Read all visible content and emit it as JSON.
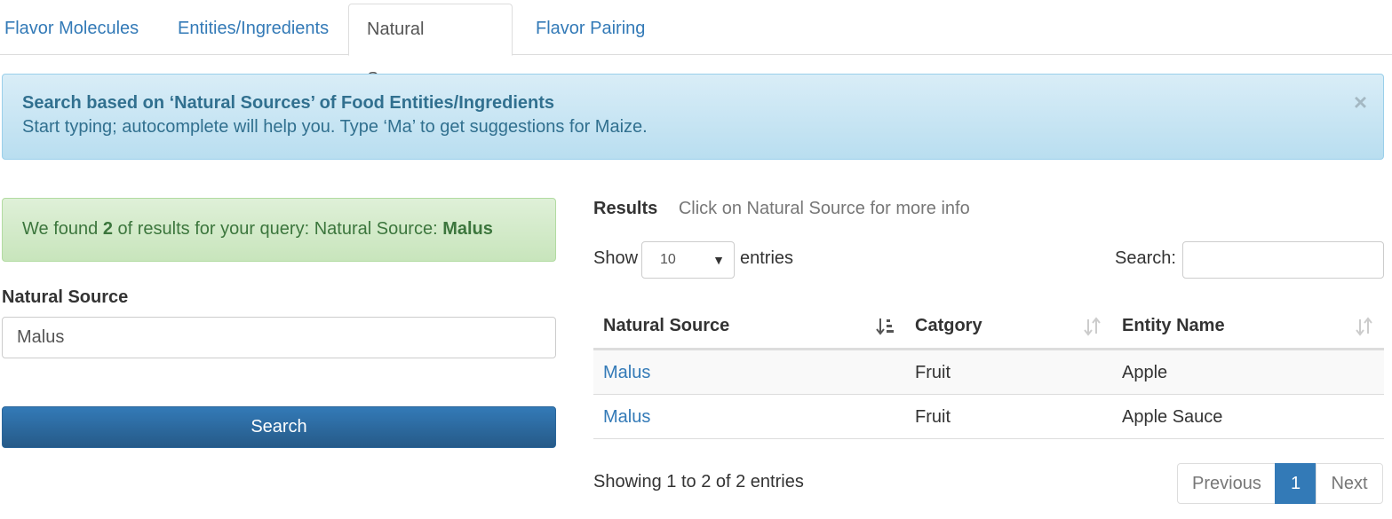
{
  "tabs": [
    {
      "label": "Flavor Molecules"
    },
    {
      "label": "Entities/Ingredients"
    },
    {
      "label": "Natural Sources"
    },
    {
      "label": "Flavor Pairing"
    }
  ],
  "info_alert": {
    "title": "Search based on ‘Natural Sources’ of Food Entities/Ingredients",
    "text": "Start typing; autocomplete will help you. Type ‘Ma’ to get suggestions for Maize.",
    "close": "×"
  },
  "success_alert": {
    "prefix": "We found ",
    "count": "2",
    "middle": " of results for your query: Natural Source: ",
    "query": "Malus"
  },
  "form": {
    "label": "Natural Source",
    "value": "Malus",
    "button": "Search"
  },
  "results": {
    "title": "Results",
    "subtitle": "Click on Natural Source for more info",
    "show_label": "Show",
    "page_size": "10",
    "entries_label": "entries",
    "search_label": "Search:",
    "columns": [
      "Natural Source",
      "Catgory",
      "Entity Name"
    ],
    "rows": [
      {
        "source": "Malus",
        "category": "Fruit",
        "entity": "Apple"
      },
      {
        "source": "Malus",
        "category": "Fruit",
        "entity": "Apple Sauce"
      }
    ],
    "info": "Showing 1 to 2 of 2 entries",
    "pagination": {
      "previous": "Previous",
      "current": "1",
      "next": "Next"
    }
  }
}
